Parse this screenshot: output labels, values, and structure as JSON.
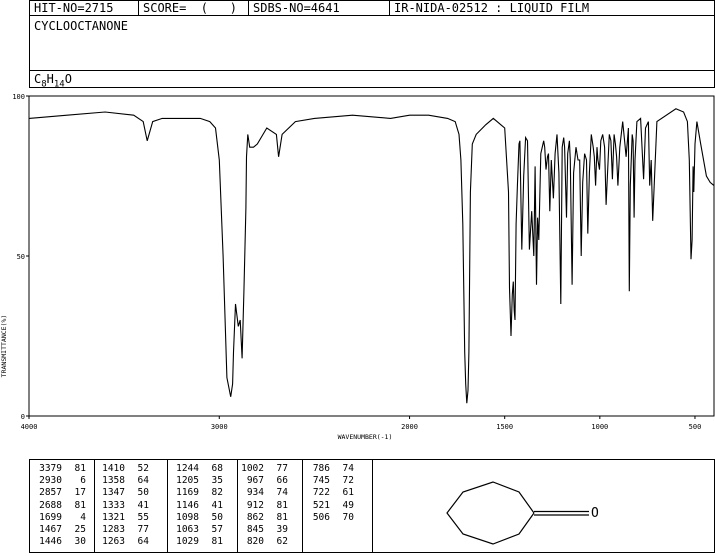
{
  "header": {
    "hit_no": "HIT-NO=2715",
    "score": "SCORE=  (   )",
    "sdbs_no": "SDBS-NO=4641",
    "ir_nida": "IR-NIDA-02512 : LIQUID FILM"
  },
  "compound_name": "CYCLOOCTANONE",
  "formula": {
    "c": "C",
    "c_sub": "8",
    "h": "H",
    "h_sub": "14",
    "o": "O"
  },
  "chart_data": {
    "type": "line",
    "xlabel": "WAVENUMBER(-1)",
    "ylabel": "TRANSMITTANCE(%)",
    "xlim": [
      4000,
      400
    ],
    "ylim": [
      0,
      100
    ],
    "x_ticks": [
      4000,
      3000,
      2000,
      1500,
      1000,
      500
    ],
    "x_tick_labels": [
      "4000",
      "3000",
      "2000",
      "1500",
      "1000",
      "500"
    ],
    "y_ticks": [
      0,
      50,
      100
    ],
    "y_tick_labels": [
      "0",
      "50",
      "100"
    ],
    "series": [
      {
        "x": [
          4000,
          3800,
          3600,
          3450,
          3400,
          3379,
          3350,
          3300,
          3200,
          3100,
          3050,
          3020,
          3000,
          2980,
          2960,
          2940,
          2930,
          2925,
          2915,
          2900,
          2890,
          2880,
          2870,
          2860,
          2857,
          2850,
          2840,
          2820,
          2800,
          2750,
          2700,
          2688,
          2670,
          2600,
          2500,
          2300,
          2100,
          2000,
          1900,
          1800,
          1760,
          1740,
          1730,
          1720,
          1710,
          1705,
          1699,
          1693,
          1688,
          1680,
          1670,
          1650,
          1600,
          1560,
          1540,
          1520,
          1500,
          1480,
          1475,
          1467,
          1460,
          1455,
          1450,
          1446,
          1440,
          1433,
          1425,
          1420,
          1410,
          1400,
          1390,
          1380,
          1370,
          1358,
          1347,
          1340,
          1333,
          1327,
          1321,
          1310,
          1295,
          1290,
          1283,
          1275,
          1270,
          1263,
          1255,
          1244,
          1235,
          1225,
          1215,
          1205,
          1198,
          1190,
          1185,
          1175,
          1169,
          1160,
          1155,
          1146,
          1138,
          1125,
          1115,
          1106,
          1098,
          1090,
          1080,
          1070,
          1063,
          1055,
          1045,
          1035,
          1029,
          1022,
          1015,
          1010,
          1002,
          995,
          985,
          975,
          967,
          960,
          950,
          942,
          934,
          925,
          918,
          912,
          905,
          895,
          880,
          870,
          862,
          855,
          850,
          845,
          840,
          830,
          825,
          820,
          815,
          805,
          786,
          770,
          760,
          745,
          738,
          730,
          722,
          700,
          600,
          560,
          540,
          530,
          521,
          515,
          510,
          506,
          500,
          490,
          470,
          440,
          420,
          400
        ],
        "y": [
          93,
          94,
          95,
          94,
          92,
          86,
          92,
          93,
          93,
          93,
          92,
          90,
          80,
          50,
          12,
          6,
          10,
          20,
          35,
          28,
          30,
          18,
          40,
          65,
          81,
          88,
          84,
          84,
          85,
          90,
          88,
          81,
          88,
          92,
          93,
          94,
          93,
          94,
          94,
          93,
          92,
          88,
          80,
          60,
          20,
          10,
          4,
          8,
          20,
          70,
          85,
          88,
          91,
          93,
          92,
          91,
          90,
          70,
          40,
          25,
          38,
          42,
          33,
          30,
          60,
          72,
          85,
          86,
          52,
          75,
          87,
          86,
          52,
          64,
          50,
          78,
          41,
          62,
          55,
          82,
          86,
          84,
          77,
          81,
          82,
          64,
          80,
          68,
          82,
          88,
          76,
          35,
          84,
          87,
          84,
          62,
          82,
          86,
          80,
          41,
          76,
          84,
          80,
          80,
          50,
          73,
          82,
          80,
          57,
          76,
          88,
          84,
          81,
          72,
          84,
          80,
          77,
          86,
          88,
          84,
          66,
          75,
          88,
          86,
          74,
          88,
          85,
          81,
          72,
          84,
          92,
          86,
          81,
          86,
          90,
          39,
          72,
          88,
          86,
          62,
          80,
          92,
          93,
          74,
          90,
          92,
          72,
          80,
          61,
          92,
          96,
          95,
          92,
          80,
          49,
          55,
          78,
          70,
          85,
          92,
          85,
          75,
          73,
          72
        ]
      }
    ]
  },
  "peaks": {
    "columns": [
      [
        [
          "3379",
          "81"
        ],
        [
          "2930",
          "6"
        ],
        [
          "2857",
          "17"
        ],
        [
          "2688",
          "81"
        ],
        [
          "1699",
          "4"
        ],
        [
          "1467",
          "25"
        ],
        [
          "1446",
          "30"
        ]
      ],
      [
        [
          "1410",
          "52"
        ],
        [
          "1358",
          "64"
        ],
        [
          "1347",
          "50"
        ],
        [
          "1333",
          "41"
        ],
        [
          "1321",
          "55"
        ],
        [
          "1283",
          "77"
        ],
        [
          "1263",
          "64"
        ]
      ],
      [
        [
          "1244",
          "68"
        ],
        [
          "1205",
          "35"
        ],
        [
          "1169",
          "82"
        ],
        [
          "1146",
          "41"
        ],
        [
          "1098",
          "50"
        ],
        [
          "1063",
          "57"
        ],
        [
          "1029",
          "81"
        ]
      ],
      [
        [
          "1002",
          "77"
        ],
        [
          "967",
          "66"
        ],
        [
          "934",
          "74"
        ],
        [
          "912",
          "81"
        ],
        [
          "862",
          "81"
        ],
        [
          "845",
          "39"
        ],
        [
          "820",
          "62"
        ]
      ],
      [
        [
          "786",
          "74"
        ],
        [
          "745",
          "72"
        ],
        [
          "722",
          "61"
        ],
        [
          "521",
          "49"
        ],
        [
          "506",
          "70"
        ]
      ]
    ]
  },
  "structure": {
    "oxygen_label": "O"
  }
}
